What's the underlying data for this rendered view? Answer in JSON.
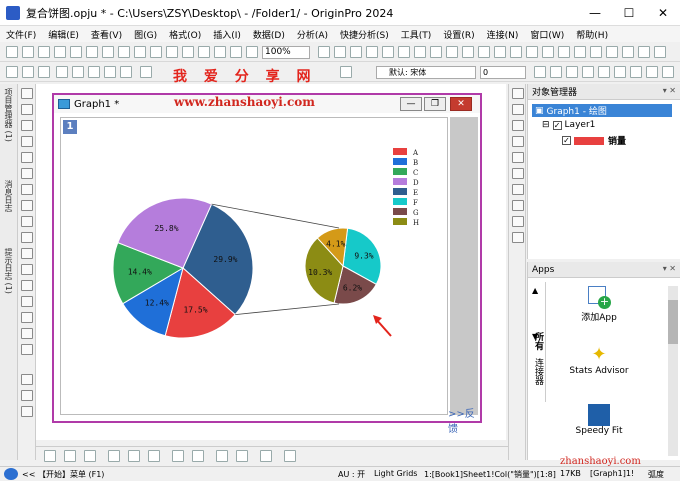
{
  "window": {
    "title": "复合饼图.opju * - C:\\Users\\ZSY\\Desktop\\ - /Folder1/ - OriginPro 2024",
    "min": "—",
    "max": "☐",
    "close": "✕"
  },
  "menu": [
    "文件(F)",
    "编辑(E)",
    "查看(V)",
    "图(G)",
    "格式(O)",
    "插入(I)",
    "数据(D)",
    "分析(A)",
    "快捷分析(S)",
    "工具(T)",
    "设置(R)",
    "连接(N)",
    "窗口(W)",
    "帮助(H)"
  ],
  "toolbar2": {
    "zoom": "100%",
    "font": "默认: 宋体",
    "size": "0"
  },
  "left_tabs": [
    "项目管理器 (1)",
    "消息日志",
    "提示日志 (1)"
  ],
  "watermark": {
    "text": "我 爱 分 享 网",
    "url": "www.zhanshaoyi.com",
    "url2": "zhanshaoyi.com"
  },
  "graph": {
    "title": "Graph1 *",
    "layer": "1",
    "feedback": ">>反馈",
    "legend": [
      "A",
      "B",
      "C",
      "D",
      "E",
      "F",
      "G",
      "H"
    ],
    "colors": {
      "A": "#e8403f",
      "B": "#1f6fd8",
      "C": "#33a85a",
      "D": "#b57ddc",
      "E": "#2f5e8f",
      "F": "#16c9c9",
      "G": "#7a4a4a",
      "H": "#8c8c14"
    },
    "labels": {
      "A": "17.5%",
      "B": "12.4%",
      "C": "14.4%",
      "D": "25.8%",
      "E": "29.9%",
      "F": "9.3%",
      "G": "6.2%",
      "H": "10.3%",
      "I": "4.1%"
    }
  },
  "chart_data": {
    "type": "pie",
    "categories": [
      "A",
      "B",
      "C",
      "D",
      "E",
      "F",
      "G",
      "H"
    ],
    "main_pie": [
      {
        "category": "E",
        "value": 29.9
      },
      {
        "category": "A",
        "value": 17.5
      },
      {
        "category": "B",
        "value": 12.4
      },
      {
        "category": "C",
        "value": 14.4
      },
      {
        "category": "D",
        "value": 25.8
      }
    ],
    "secondary_pie": [
      {
        "category": "F",
        "value": 9.3
      },
      {
        "category": "G",
        "value": 6.2
      },
      {
        "category": "H",
        "value": 10.3
      },
      {
        "category": "E",
        "value": 4.1
      }
    ],
    "legend_position": "top-right"
  },
  "object_manager": {
    "title": "对象管理器",
    "graph": "Graph1 - 绘图",
    "layer": "Layer1",
    "series": "销量"
  },
  "apps": {
    "title": "Apps",
    "items": [
      "添加App",
      "Stats Advisor",
      "Speedy Fit"
    ],
    "tabs": [
      "所有",
      "连接器"
    ]
  },
  "status": {
    "start": "<< 【开始】菜单 (F1)",
    "au": "AU : 开",
    "grids": "Light Grids",
    "ref": "1:[Book1]Sheet1!Col(\"销量\")[1:8]",
    "size": "17KB",
    "graph": "[Graph1]1!",
    "unit": "弧度"
  }
}
